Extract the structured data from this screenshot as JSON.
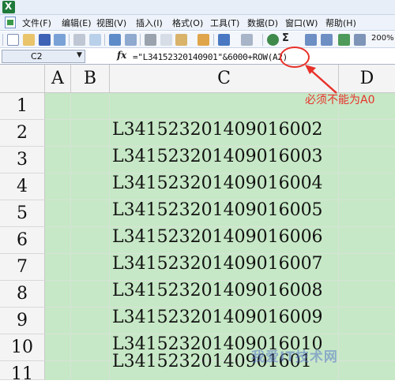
{
  "menu": {
    "items": [
      "文件(F)",
      "编辑(E)",
      "视图(V)",
      "插入(I)",
      "格式(O)",
      "工具(T)",
      "数据(D)",
      "窗口(W)",
      "帮助(H)"
    ]
  },
  "toolbar": {
    "zoom": "200%"
  },
  "formula_bar": {
    "cell_ref": "C2",
    "fx": "fx",
    "formula": "=\"L34152320140901\"&6000+ROW(A2)"
  },
  "sheet": {
    "columns": [
      "A",
      "B",
      "C",
      "D"
    ],
    "rows": [
      "1",
      "2",
      "3",
      "4",
      "5",
      "6",
      "7",
      "8",
      "9",
      "10",
      "11"
    ],
    "column_c_values": [
      "",
      "L341523201409016002",
      "L341523201409016003",
      "L341523201409016004",
      "L341523201409016005",
      "L341523201409016006",
      "L341523201409016007",
      "L341523201409016008",
      "L341523201409016009",
      "L341523201409016010",
      "L34152320140901601"
    ]
  },
  "annotation": {
    "text": "必须不能为A0",
    "color": "#e8312a"
  },
  "watermark": "我爱IT技术网",
  "colors": {
    "cell_fill": "#c6e8c6",
    "header_fill": "#f4f4f4",
    "annotation": "#e8312a"
  }
}
